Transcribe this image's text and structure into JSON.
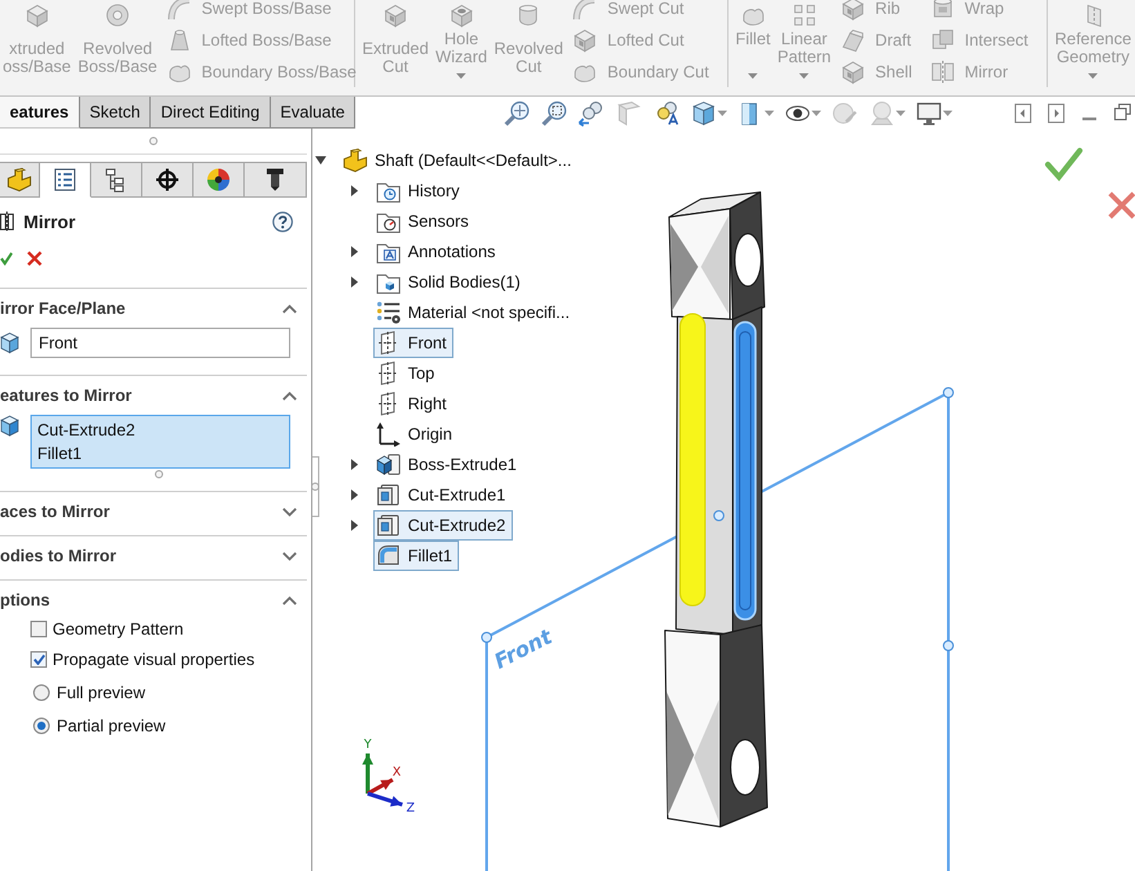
{
  "ribbon": {
    "groups": [
      {
        "large": [
          {
            "kind": "extrude",
            "label": "xtruded\noss/Base",
            "disabled": true,
            "dropdown": false
          },
          {
            "kind": "revolve",
            "label": "Revolved\nBoss/Base",
            "disabled": true,
            "dropdown": false
          }
        ],
        "columns": [
          [
            {
              "kind": "sweep",
              "label": "Swept Boss/Base",
              "disabled": true
            },
            {
              "kind": "loft",
              "label": "Lofted Boss/Base",
              "disabled": true
            },
            {
              "kind": "boundary",
              "label": "Boundary Boss/Base",
              "disabled": true
            }
          ]
        ]
      },
      {
        "large": [
          {
            "kind": "extrudecut",
            "label": "Extruded\nCut",
            "disabled": true,
            "dropdown": false
          },
          {
            "kind": "hole",
            "label": "Hole\nWizard",
            "disabled": true,
            "dropdown": true
          },
          {
            "kind": "revolvecut",
            "label": "Revolved\nCut",
            "disabled": true,
            "dropdown": false
          }
        ],
        "columns": [
          [
            {
              "kind": "sweepcut",
              "label": "Swept Cut",
              "disabled": true
            },
            {
              "kind": "loftcut",
              "label": "Lofted Cut",
              "disabled": true
            },
            {
              "kind": "boundarycut",
              "label": "Boundary Cut",
              "disabled": true
            }
          ]
        ]
      },
      {
        "large": [
          {
            "kind": "fillet",
            "label": "Fillet",
            "disabled": true,
            "dropdown": true
          },
          {
            "kind": "pattern",
            "label": "Linear\nPattern",
            "disabled": true,
            "dropdown": true
          }
        ],
        "columns": [
          [
            {
              "kind": "rib",
              "label": "Rib",
              "disabled": true
            },
            {
              "kind": "draft",
              "label": "Draft",
              "disabled": true
            },
            {
              "kind": "shell",
              "label": "Shell",
              "disabled": true
            }
          ],
          [
            {
              "kind": "wrap",
              "label": "Wrap",
              "disabled": true
            },
            {
              "kind": "intersect",
              "label": "Intersect",
              "disabled": true
            },
            {
              "kind": "mirror",
              "label": "Mirror",
              "disabled": true
            }
          ]
        ]
      },
      {
        "large": [
          {
            "kind": "refgeom",
            "label": "Reference\nGeometry",
            "disabled": true,
            "dropdown": true
          }
        ]
      }
    ]
  },
  "tabs": [
    {
      "label": "eatures",
      "selected": true
    },
    {
      "label": "Sketch",
      "selected": false
    },
    {
      "label": "Direct Editing",
      "selected": false
    },
    {
      "label": "Evaluate",
      "selected": false
    }
  ],
  "view_toolbar": {
    "tools": [
      {
        "kind": "zoomfit",
        "dropdown": false
      },
      {
        "kind": "zoomarea",
        "dropdown": false
      },
      {
        "kind": "previous",
        "dropdown": false
      },
      {
        "kind": "section",
        "dropdown": false
      },
      {
        "kind": "annotation",
        "dropdown": false
      },
      {
        "kind": "orientation",
        "dropdown": true
      },
      {
        "kind": "display",
        "dropdown": true
      },
      {
        "kind": "hideshow",
        "dropdown": true
      },
      {
        "kind": "appearance",
        "dropdown": false
      },
      {
        "kind": "scene",
        "dropdown": true
      },
      {
        "kind": "settings",
        "dropdown": true
      }
    ],
    "window_controls": [
      {
        "kind": "tileleft"
      },
      {
        "kind": "tileright"
      },
      {
        "kind": "minimize"
      },
      {
        "kind": "restore"
      }
    ]
  },
  "panel": {
    "tabs": [
      {
        "kind": "part",
        "selected": false
      },
      {
        "kind": "property",
        "selected": true
      },
      {
        "kind": "config",
        "selected": false
      },
      {
        "kind": "dimxpert",
        "selected": false
      },
      {
        "kind": "appearance",
        "selected": false
      },
      {
        "kind": "cam",
        "selected": false
      }
    ],
    "title": "Mirror",
    "sections": [
      {
        "kind": "field",
        "title": "irror Face/Plane",
        "expanded": true,
        "value": "Front"
      },
      {
        "kind": "list",
        "title": "eatures to Mirror",
        "expanded": true,
        "items": [
          "Cut-Extrude2",
          "Fillet1"
        ]
      },
      {
        "title": "aces to Mirror",
        "expanded": false
      },
      {
        "title": "odies to Mirror",
        "expanded": false
      },
      {
        "kind": "options",
        "title": "ptions",
        "expanded": true,
        "options": [
          {
            "kind": "checkbox",
            "label": "Geometry Pattern",
            "checked": false
          },
          {
            "kind": "checkbox",
            "label": "Propagate visual properties",
            "checked": true
          },
          {
            "kind": "radio",
            "label": "Full preview",
            "selected": false
          },
          {
            "kind": "radio",
            "label": "Partial preview",
            "selected": true
          }
        ]
      }
    ]
  },
  "tree": {
    "kind": "part",
    "label": "Shaft (Default<<Default>...",
    "expander": true,
    "expanded": true,
    "selected": false,
    "children": [
      {
        "kind": "history",
        "label": "History",
        "expander": true,
        "expanded": false,
        "selected": false
      },
      {
        "kind": "sensors",
        "label": "Sensors",
        "expander": false,
        "selected": false
      },
      {
        "kind": "annotations",
        "label": "Annotations",
        "expander": true,
        "expanded": false,
        "selected": false
      },
      {
        "kind": "bodies",
        "label": "Solid Bodies(1)",
        "expander": true,
        "expanded": false,
        "selected": false
      },
      {
        "kind": "material",
        "label": "Material <not specifi...",
        "expander": false,
        "selected": false
      },
      {
        "kind": "plane",
        "label": "Front",
        "expander": false,
        "selected": true
      },
      {
        "kind": "plane",
        "label": "Top",
        "expander": false,
        "selected": false
      },
      {
        "kind": "plane",
        "label": "Right",
        "expander": false,
        "selected": false
      },
      {
        "kind": "origin",
        "label": "Origin",
        "expander": false,
        "selected": false
      },
      {
        "kind": "boss",
        "label": "Boss-Extrude1",
        "expander": true,
        "expanded": false,
        "selected": false
      },
      {
        "kind": "cut",
        "label": "Cut-Extrude1",
        "expander": true,
        "expanded": false,
        "selected": false
      },
      {
        "kind": "cut",
        "label": "Cut-Extrude2",
        "expander": true,
        "expanded": false,
        "selected": true
      },
      {
        "kind": "fillet",
        "label": "Fillet1",
        "expander": false,
        "selected": true
      }
    ]
  },
  "scene": {
    "plane_label": "Front",
    "triad": [
      {
        "kind": "y",
        "label": "Y",
        "color": "#1f8a2e"
      },
      {
        "kind": "x",
        "label": "X",
        "color": "#b81c1c"
      },
      {
        "kind": "z",
        "label": "Z",
        "color": "#1c2cc8"
      }
    ]
  }
}
